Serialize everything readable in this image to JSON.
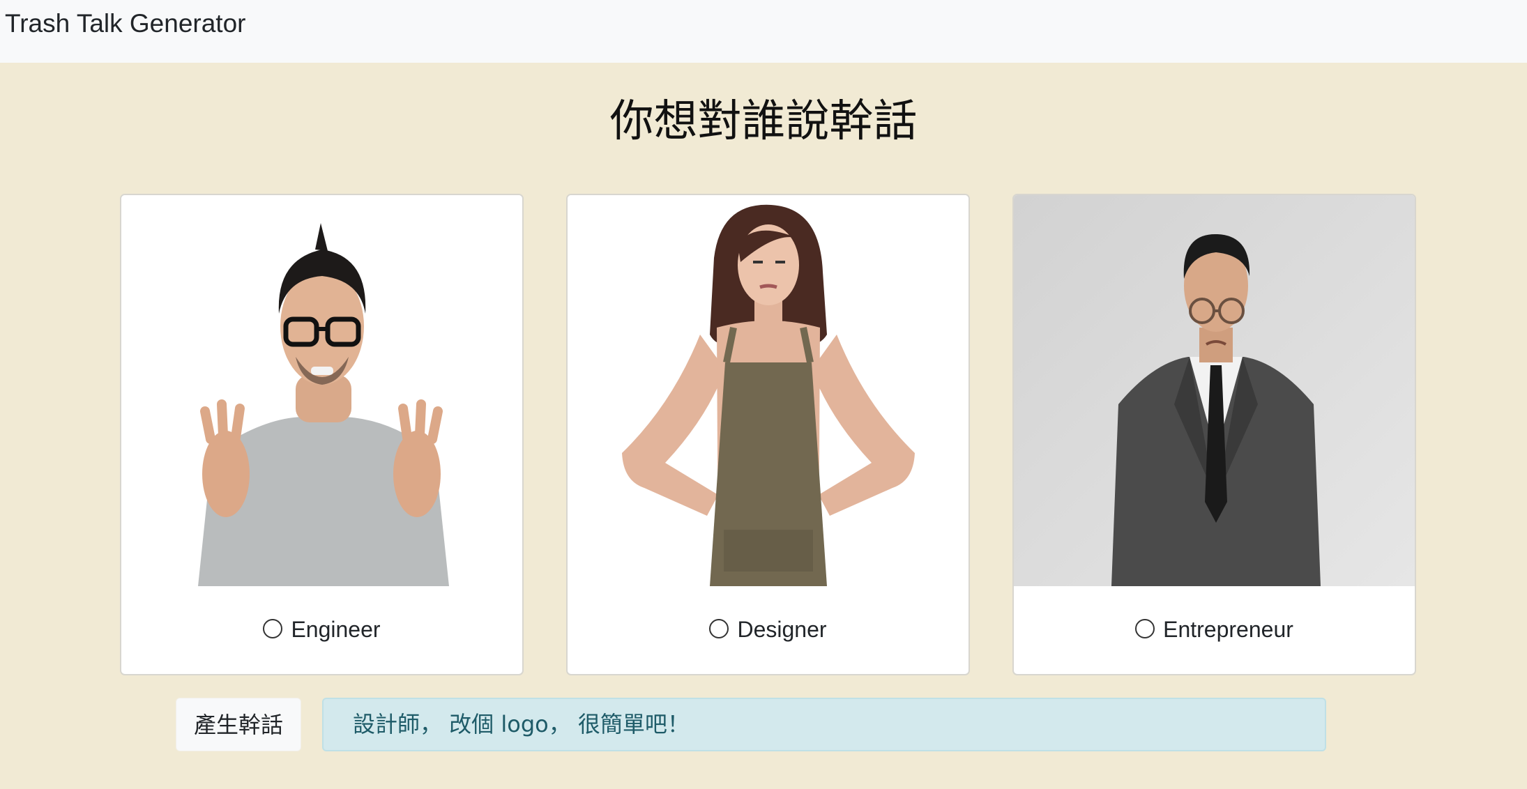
{
  "navbar": {
    "brand": "Trash Talk Generator"
  },
  "main": {
    "heading": "你想對誰說幹話",
    "options": [
      {
        "label": "Engineer",
        "selected": false
      },
      {
        "label": "Designer",
        "selected": false
      },
      {
        "label": "Entrepreneur",
        "selected": false
      }
    ],
    "generate_button": "產生幹話",
    "result_text": "設計師， 改個 logo， 很簡單吧！"
  },
  "colors": {
    "page_background": "#f1ead4",
    "navbar_background": "#f8f9fa",
    "result_background": "#d3e9ed",
    "result_text": "#1e5b68"
  }
}
